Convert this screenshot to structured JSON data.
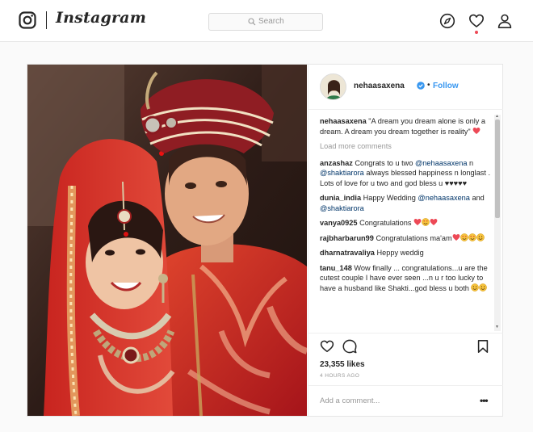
{
  "nav": {
    "wordmark": "Instagram",
    "search_placeholder": "Search"
  },
  "post": {
    "author": "nehaasaxena",
    "follow_label": "Follow",
    "dot_separator": "•",
    "likes": "23,355 likes",
    "timestamp": "4 HOURS AGO",
    "add_comment_placeholder": "Add a comment...",
    "more_label": "•••",
    "load_more": "Load more comments",
    "comments": [
      {
        "user": "nehaasaxena",
        "parts": [
          {
            "t": "text",
            "v": "\"A dream you dream alone is only a dream. A dream you dream together is reality\" "
          },
          {
            "t": "emoji",
            "v": "heart"
          }
        ]
      },
      {
        "user": "anzashaz",
        "parts": [
          {
            "t": "text",
            "v": "Congrats to u two "
          },
          {
            "t": "mention",
            "v": "@nehaasaxena"
          },
          {
            "t": "text",
            "v": " n "
          },
          {
            "t": "mention",
            "v": "@shaktiarora"
          },
          {
            "t": "text",
            "v": " always blessed happiness n longlast . Lots of love for u two and god bless u ♥♥♥♥♥"
          }
        ]
      },
      {
        "user": "dunia_india",
        "parts": [
          {
            "t": "text",
            "v": "Happy Wedding "
          },
          {
            "t": "mention",
            "v": "@nehaasaxena"
          },
          {
            "t": "text",
            "v": " and "
          },
          {
            "t": "mention",
            "v": "@shaktiarora"
          }
        ]
      },
      {
        "user": "vanya0925",
        "parts": [
          {
            "t": "text",
            "v": "Congratulations "
          },
          {
            "t": "emoji",
            "v": "heart"
          },
          {
            "t": "emoji",
            "v": "heart-eyes"
          },
          {
            "t": "emoji",
            "v": "heart"
          }
        ]
      },
      {
        "user": "rajbharbarun99",
        "parts": [
          {
            "t": "text",
            "v": "Congratulations ma'am"
          },
          {
            "t": "emoji",
            "v": "heart"
          },
          {
            "t": "emoji",
            "v": "heart-eyes"
          },
          {
            "t": "emoji",
            "v": "heart-eyes"
          },
          {
            "t": "emoji",
            "v": "smile"
          }
        ]
      },
      {
        "user": "dharnatravaliya",
        "parts": [
          {
            "t": "text",
            "v": "Heppy weddig"
          }
        ]
      },
      {
        "user": "tanu_148",
        "parts": [
          {
            "t": "text",
            "v": "Wow finally ... congratulations...u are the cutest couple I have ever seen ...n u r too lucky to have a husband like Shakti...god bless u both "
          },
          {
            "t": "emoji",
            "v": "smile"
          },
          {
            "t": "emoji",
            "v": "smile"
          }
        ]
      }
    ]
  },
  "colors": {
    "accent": "#3897f0",
    "text": "#262626",
    "muted": "#999999",
    "mention": "#003569",
    "heart": "#ed4956"
  }
}
